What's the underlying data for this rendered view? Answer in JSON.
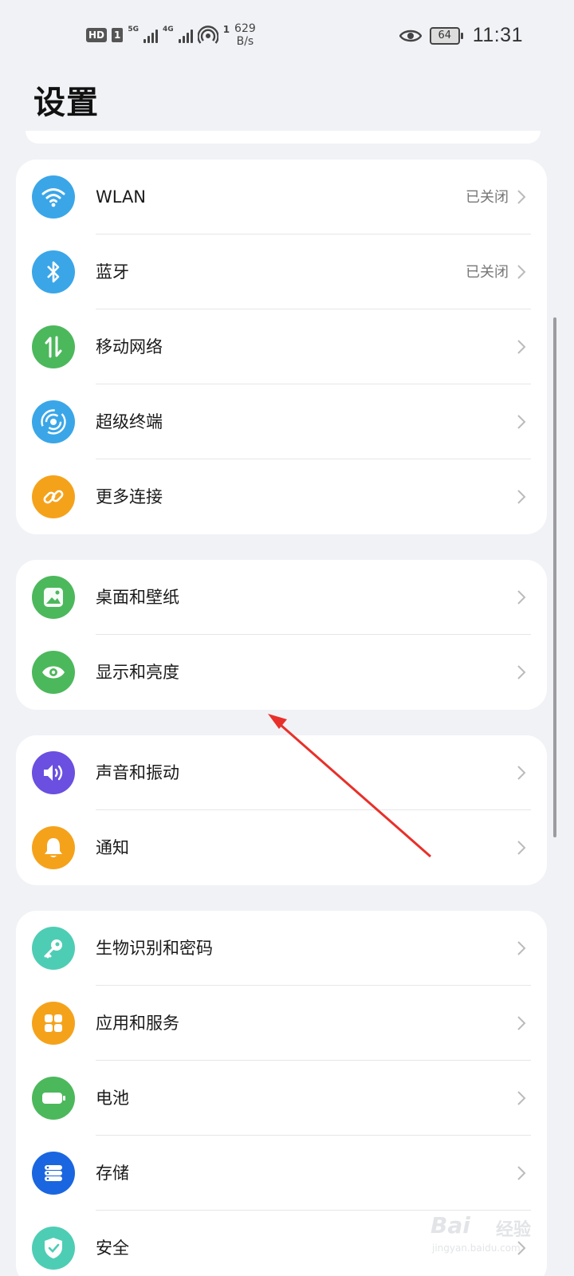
{
  "status_bar": {
    "hd": "HD",
    "sim1": "1",
    "net1": "5G",
    "net2": "4G",
    "hotspot_count": "1",
    "speed_value": "629",
    "speed_unit": "B/s",
    "eye_icon": "eye-icon",
    "battery": "64",
    "time": "11:31"
  },
  "title": "设置",
  "groups": [
    {
      "items": [
        {
          "label": "WLAN",
          "value": "已关闭",
          "icon": "wifi-icon",
          "color": "#3aa6e8"
        },
        {
          "label": "蓝牙",
          "value": "已关闭",
          "icon": "bluetooth-icon",
          "color": "#3aa6e8"
        },
        {
          "label": "移动网络",
          "value": "",
          "icon": "mobile-data-icon",
          "color": "#4cb85c"
        },
        {
          "label": "超级终端",
          "value": "",
          "icon": "super-device-icon",
          "color": "#3aa6e8"
        },
        {
          "label": "更多连接",
          "value": "",
          "icon": "link-icon",
          "color": "#f5a21b"
        }
      ]
    },
    {
      "items": [
        {
          "label": "桌面和壁纸",
          "value": "",
          "icon": "wallpaper-icon",
          "color": "#4cb85c"
        },
        {
          "label": "显示和亮度",
          "value": "",
          "icon": "display-eye-icon",
          "color": "#4cb85c"
        }
      ]
    },
    {
      "items": [
        {
          "label": "声音和振动",
          "value": "",
          "icon": "sound-icon",
          "color": "#6a4fe0"
        },
        {
          "label": "通知",
          "value": "",
          "icon": "bell-icon",
          "color": "#f5a21b"
        }
      ]
    },
    {
      "items": [
        {
          "label": "生物识别和密码",
          "value": "",
          "icon": "key-icon",
          "color": "#4ecdb5"
        },
        {
          "label": "应用和服务",
          "value": "",
          "icon": "apps-icon",
          "color": "#f5a21b"
        },
        {
          "label": "电池",
          "value": "",
          "icon": "battery-icon",
          "color": "#4cb85c"
        },
        {
          "label": "存储",
          "value": "",
          "icon": "storage-icon",
          "color": "#1a66e0"
        },
        {
          "label": "安全",
          "value": "",
          "icon": "shield-icon",
          "color": "#4ecdb5"
        }
      ]
    }
  ],
  "watermark": {
    "brand": "Bai",
    "cn": "经验",
    "url": "jingyan.baidu.com"
  }
}
